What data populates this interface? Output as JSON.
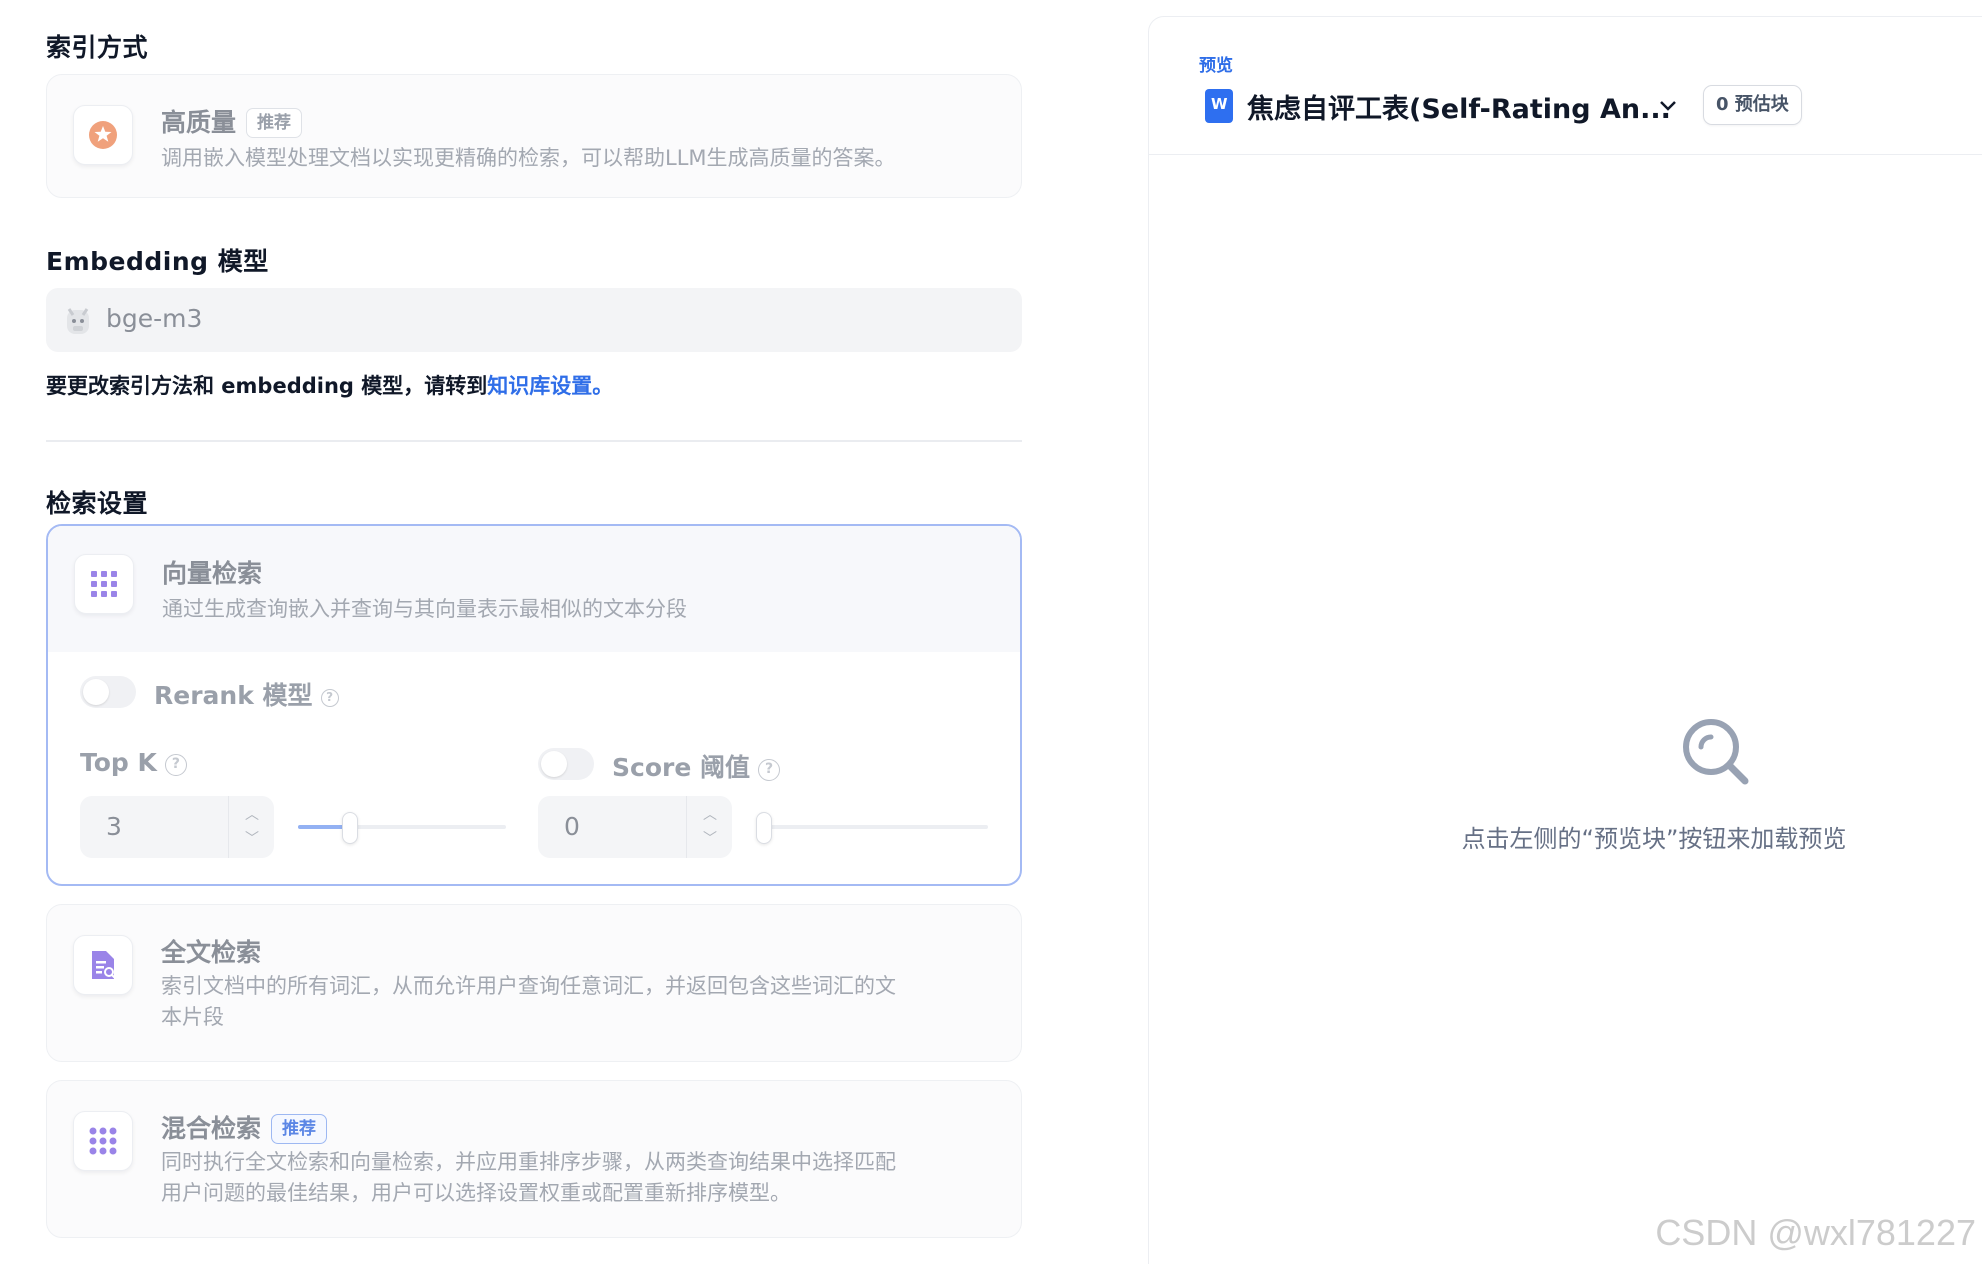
{
  "index_section": {
    "title": "索引方式",
    "high_quality": {
      "title": "高质量",
      "badge": "推荐",
      "description": "调用嵌入模型处理文档以实现更精确的检索，可以帮助LLM生成高质量的答案。"
    }
  },
  "embedding_section": {
    "title": "Embedding 模型",
    "model_name": "bge-m3",
    "hint_prefix": "要更改索引方法和 embedding 模型，请转到",
    "hint_link": "知识库设置。"
  },
  "retrieval_section": {
    "title": "检索设置",
    "vector": {
      "title": "向量检索",
      "description": "通过生成查询嵌入并查询与其向量表示最相似的文本分段",
      "rerank_label": "Rerank 模型",
      "rerank_enabled": false,
      "topk_label": "Top K",
      "topk_value": "3",
      "topk_slider_fraction": 0.25,
      "score_label": "Score 阈值",
      "score_enabled": false,
      "score_value": "0",
      "score_slider_fraction": 0
    },
    "fulltext": {
      "title": "全文检索",
      "description_line1": "索引文档中的所有词汇，从而允许用户查询任意词汇，并返回包含这些词汇的文",
      "description_line2": "本片段"
    },
    "hybrid": {
      "title": "混合检索",
      "badge": "推荐",
      "description_line1": "同时执行全文检索和向量检索，并应用重排序步骤，从两类查询结果中选择匹配",
      "description_line2": "用户问题的最佳结果，用户可以选择设置权重或配置重新排序模型。"
    }
  },
  "preview": {
    "kicker": "预览",
    "doc_title": "焦虑自评工表(Self-Rating An...",
    "chunk_button": "0 预估块",
    "empty_text": "点击左侧的“预览块”按钮来加载预览"
  },
  "watermark": "CSDN @wxl781227",
  "colors": {
    "accent": "#2f6ee8",
    "active_border": "#a4baf4",
    "heading": "#101828"
  }
}
